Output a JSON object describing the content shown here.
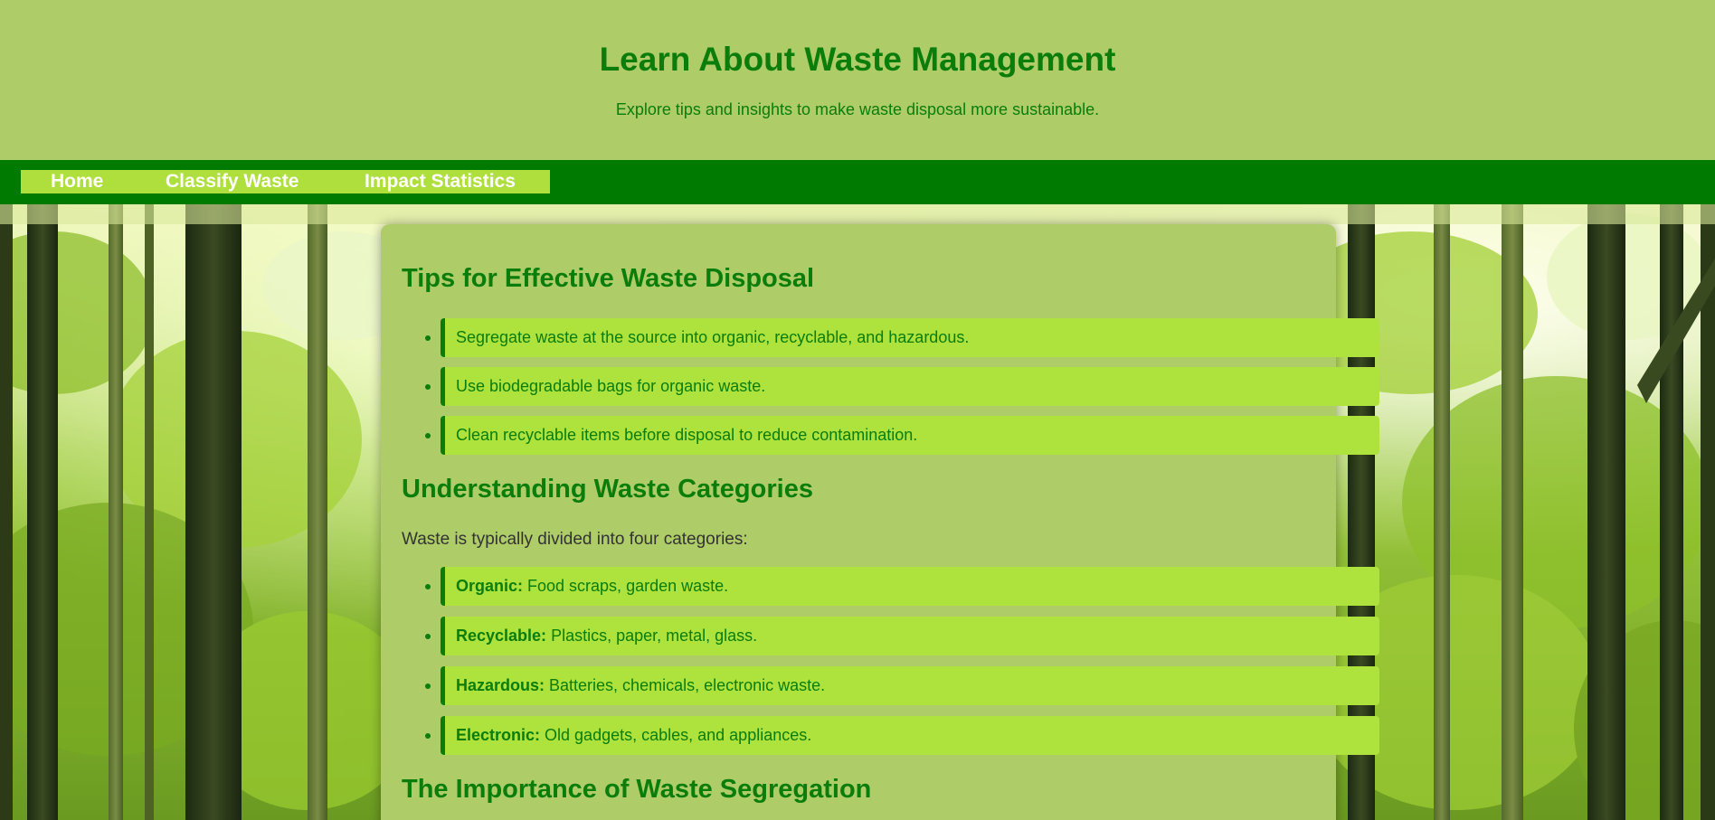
{
  "header": {
    "title": "Learn About Waste Management",
    "subtitle": "Explore tips and insights to make waste disposal more sustainable."
  },
  "nav": {
    "items": [
      {
        "label": "Home"
      },
      {
        "label": "Classify Waste"
      },
      {
        "label": "Impact Statistics"
      }
    ]
  },
  "tips": {
    "heading": "Tips for Effective Waste Disposal",
    "items": [
      "Segregate waste at the source into organic, recyclable, and hazardous.",
      "Use biodegradable bags for organic waste.",
      "Clean recyclable items before disposal to reduce contamination."
    ]
  },
  "categories": {
    "heading": "Understanding Waste Categories",
    "intro": "Waste is typically divided into four categories:",
    "items": [
      {
        "term": "Organic:",
        "desc": " Food scraps, garden waste."
      },
      {
        "term": "Recyclable:",
        "desc": " Plastics, paper, metal, glass."
      },
      {
        "term": "Hazardous:",
        "desc": " Batteries, chemicals, electronic waste."
      },
      {
        "term": "Electronic:",
        "desc": " Old gadgets, cables, and appliances."
      }
    ]
  },
  "segregation": {
    "heading": "The Importance of Waste Segregation"
  },
  "colors": {
    "page_bg": "#aecc68",
    "heading": "#0b7d0b",
    "nav_bar": "#007a00",
    "nav_strip": "#aedf3c",
    "list_item_bg": "#aee23c"
  }
}
